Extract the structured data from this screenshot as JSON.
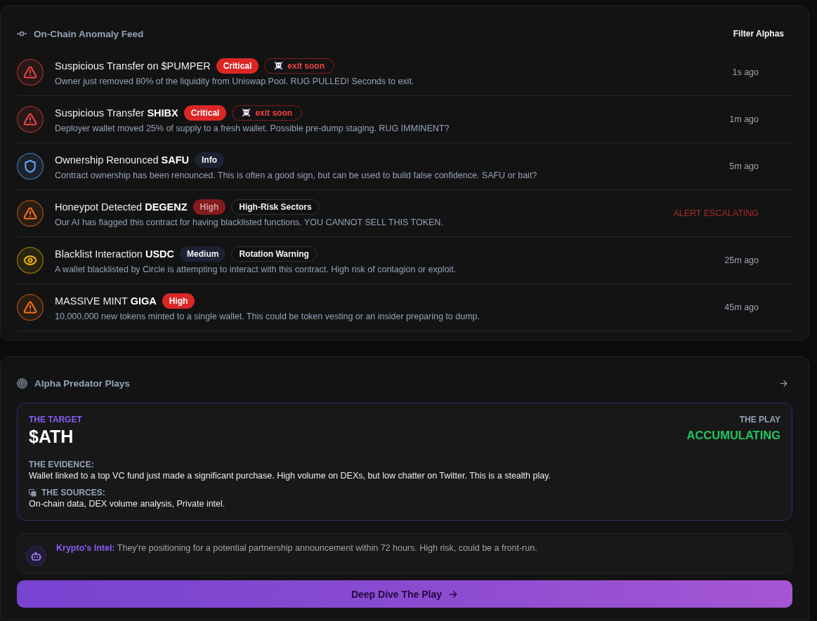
{
  "feed": {
    "title": "On-Chain Anomaly Feed",
    "filter_button": "Filter Alphas",
    "alerts": [
      {
        "kind": "danger",
        "color": "#ef4444",
        "title": "Suspicious Transfer on $PUMPER",
        "badges": [
          {
            "label": "Critical",
            "kind": "solid"
          },
          {
            "label": "exit soon",
            "kind": "alert"
          }
        ],
        "description": "Owner just removed 80% of the liquidity from Uniswap Pool. RUG PULLED! Seconds to exit.",
        "time": "1s ago",
        "time_alert": false
      },
      {
        "kind": "danger",
        "color": "#ef4444",
        "title": "Suspicious Transfer **SHIBX**",
        "badges": [
          {
            "label": "Critical",
            "kind": "solid"
          },
          {
            "label": "exit soon",
            "kind": "alert"
          }
        ],
        "description": "Deployer wallet moved 25% of supply to a fresh wallet. Possible pre-dump staging. RUG IMMINENT?",
        "time": "1m ago",
        "time_alert": false
      },
      {
        "kind": "info",
        "color": "#60a5fa",
        "title": "Ownership Renounced **SAFU**",
        "badges": [
          {
            "label": "Info",
            "kind": "navy"
          }
        ],
        "description": "Contract ownership has been renounced. This is often a good sign, but can be used to build false confidence. SAFU or bait?",
        "time": "5m ago",
        "time_alert": false
      },
      {
        "kind": "danger",
        "color": "#f97316",
        "title": "Honeypot Detected **DEGENZ**",
        "badges": [
          {
            "label": "High",
            "kind": "dim"
          },
          {
            "label": "High-Risk Sectors",
            "kind": "outline"
          }
        ],
        "description": "Our AI has flagged this contract for having blacklisted functions. YOU CANNOT SELL THIS TOKEN.",
        "time": "ALERT ESCALATING",
        "time_alert": true
      },
      {
        "kind": "watch",
        "color": "#eab308",
        "title": "Blacklist Interaction **USDC**",
        "badges": [
          {
            "label": "Medium",
            "kind": "navy"
          },
          {
            "label": "Rotation Warning",
            "kind": "outline"
          }
        ],
        "description": "A wallet blacklisted by Circle is attempting to interact with this contract. High risk of contagion or exploit.",
        "time": "25m ago",
        "time_alert": false
      },
      {
        "kind": "danger",
        "color": "#f97316",
        "title": "MASSIVE MINT **GIGA**",
        "badges": [
          {
            "label": "High",
            "kind": "solid"
          }
        ],
        "description": "10,000,000 new tokens minted to a single wallet. This could be token vesting or an insider preparing to dump.",
        "time": "45m ago",
        "time_alert": false
      }
    ]
  },
  "plays": {
    "title": "Alpha Predator Plays",
    "card": {
      "target_label": "THE TARGET",
      "target": "$ATH",
      "play_label": "THE PLAY",
      "play": "ACCUMULATING",
      "evidence_label": "THE EVIDENCE:",
      "evidence": "Wallet linked to a top VC fund just made a significant purchase. High volume on DEXs, but low chatter on Twitter. This is a stealth play.",
      "sources_label": "THE SOURCES:",
      "sources": "On-chain data, DEX volume analysis, Private intel."
    },
    "intel": "**Krypto's Intel:** They're positioning for a potential partnership announcement within 72 hours. High risk, could be a front-run.",
    "button": "Deep Dive The Play"
  }
}
